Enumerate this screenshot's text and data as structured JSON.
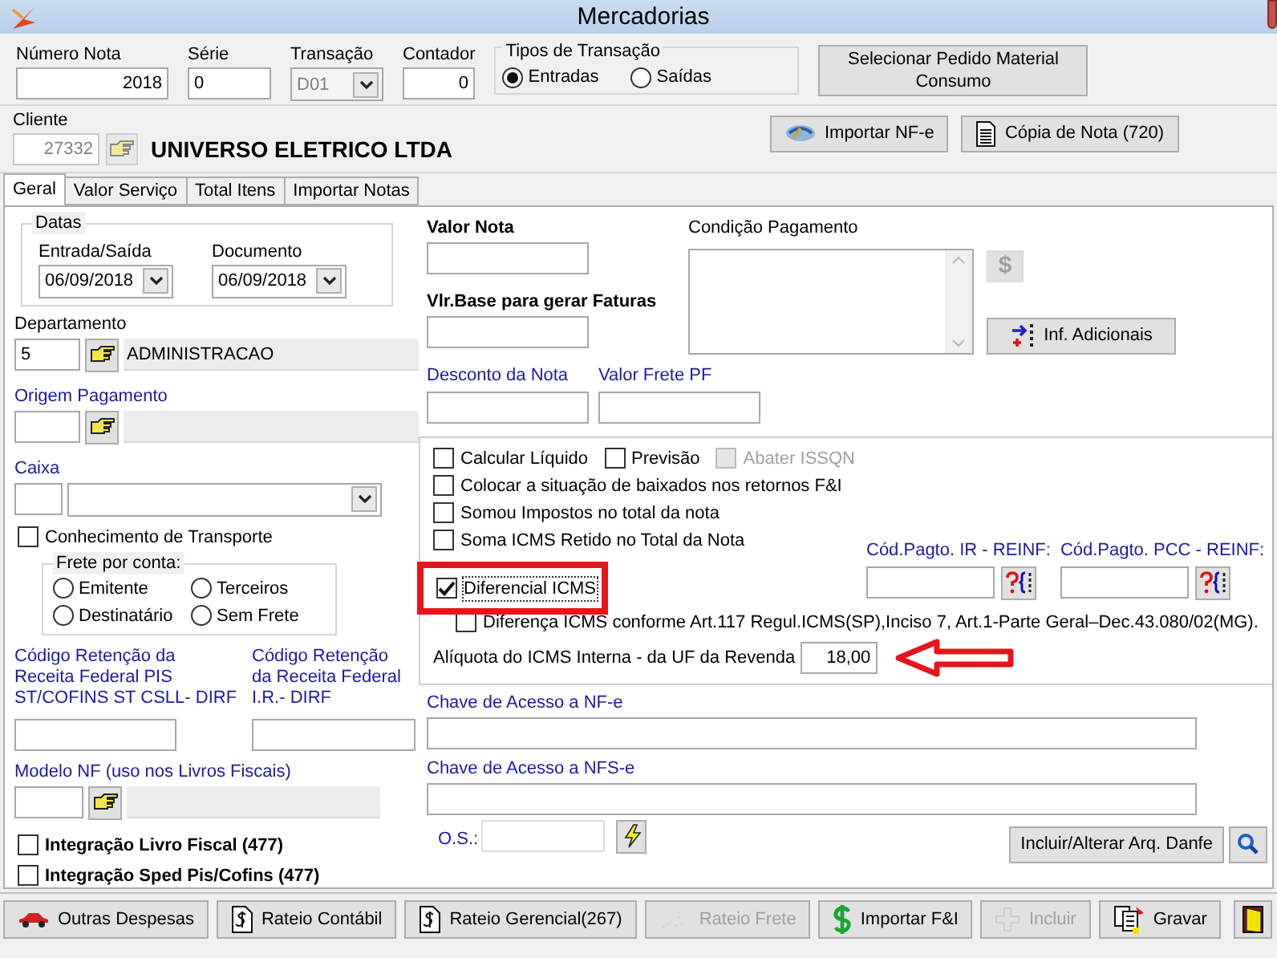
{
  "window": {
    "title": "Mercadorias"
  },
  "header": {
    "numero_nota": {
      "label": "Número Nota",
      "value": "2018"
    },
    "serie": {
      "label": "Série",
      "value": "0"
    },
    "transacao": {
      "label": "Transação",
      "value": "D01",
      "disabled": true
    },
    "contador": {
      "label": "Contador",
      "value": "0"
    },
    "tipos_transacao": {
      "title": "Tipos de Transação",
      "options": [
        {
          "label": "Entradas",
          "selected": true
        },
        {
          "label": "Saídas",
          "selected": false
        }
      ]
    },
    "select_button": "Selecionar Pedido Material Consumo"
  },
  "cliente": {
    "label": "Cliente",
    "code": "27332",
    "name": "UNIVERSO ELETRICO LTDA"
  },
  "header_buttons": [
    {
      "label": "Importar NF-e",
      "kind": "import"
    },
    {
      "label": "Cópia de Nota (720)",
      "kind": "copy"
    }
  ],
  "tabs": [
    {
      "label": "Geral",
      "selected": true
    },
    {
      "label": "Valor Serviço",
      "selected": false
    },
    {
      "label": "Total Itens",
      "selected": false
    },
    {
      "label": "Importar Notas",
      "selected": false
    }
  ],
  "left": {
    "datas": {
      "title": "Datas",
      "fields": [
        {
          "label": "Entrada/Saída",
          "value": "06/09/2018"
        },
        {
          "label": "Documento",
          "value": "06/09/2018"
        }
      ]
    },
    "departamento": {
      "label": "Departamento",
      "code": "5",
      "name": "ADMINISTRACAO"
    },
    "origem_pagamento": {
      "label": "Origem Pagamento"
    },
    "caixa": {
      "label": "Caixa"
    },
    "conhecimento_transporte": {
      "label": "Conhecimento de Transporte",
      "checked": false
    },
    "frete": {
      "title": "Frete por conta:",
      "options": [
        {
          "label": "Emitente",
          "selected": false
        },
        {
          "label": "Terceiros",
          "selected": false
        },
        {
          "label": "Destinatário",
          "selected": false
        },
        {
          "label": "Sem Frete",
          "selected": false
        }
      ]
    },
    "retencoes": [
      {
        "label": "Código Retenção da Receita Federal PIS ST/COFINS ST CSLL- DIRF"
      },
      {
        "label": "Código Retenção da Receita Federal I.R.- DIRF"
      }
    ],
    "modelo_nf": {
      "label": "Modelo NF (uso nos Livros Fiscais)"
    },
    "integracoes": [
      {
        "label": "Integração Livro Fiscal (477)",
        "checked": false
      },
      {
        "label": "Integração Sped Pis/Cofins (477)",
        "checked": false
      }
    ]
  },
  "right": {
    "valor_nota": {
      "label": "Valor Nota"
    },
    "vlr_base": {
      "label": "Vlr.Base para gerar Faturas"
    },
    "condicao_pagamento": {
      "label": "Condição Pagamento"
    },
    "dollar_button": {
      "label": "$",
      "disabled": true
    },
    "inf_adicionais": "Inf. Adicionais",
    "desconto": {
      "label": "Desconto da Nota"
    },
    "valor_frete": {
      "label": "Valor Frete PF"
    },
    "option_rows": [
      [
        {
          "label": "Calcular Líquido",
          "checked": false,
          "disabled": false
        },
        {
          "label": "Previsão",
          "checked": false,
          "disabled": false
        },
        {
          "label": "Abater ISSQN",
          "checked": false,
          "disabled": true
        }
      ],
      [
        {
          "label": "Colocar a situação de baixados nos retornos F&I",
          "checked": false,
          "disabled": false
        }
      ],
      [
        {
          "label": "Somou Impostos no total da nota",
          "checked": false,
          "disabled": false
        }
      ]
    ],
    "soma_icms": {
      "label": "Soma ICMS Retido no Total da Nota",
      "checked": false
    },
    "diferencial": {
      "label": "Diferencial ICMS",
      "checked": true,
      "highlighted": true
    },
    "diferenca": {
      "label": "Diferença ICMS conforme Art.117 Regul.ICMS(SP),Inciso 7, Art.1-Parte Geral–Dec.43.080/02(MG).",
      "checked": false
    },
    "aliquota": {
      "label": "Alíquota do ICMS Interna - da UF da Revenda",
      "value": "18,00",
      "pointed": true
    },
    "cod_pagto": [
      {
        "label": "Cód.Pagto. IR - REINF:"
      },
      {
        "label": "Cód.Pagto. PCC - REINF:"
      }
    ],
    "chave_nfe": {
      "label": "Chave de Acesso a NF-e"
    },
    "chave_nfse": {
      "label": "Chave de Acesso a NFS-e"
    },
    "os": {
      "label": "O.S.:"
    },
    "danfe_button": "Incluir/Alterar Arq. Danfe"
  },
  "toolbar": [
    {
      "label": "Outras Despesas",
      "kind": "car",
      "disabled": false
    },
    {
      "label": "Rateio Contábil",
      "kind": "doc_dollar",
      "disabled": false
    },
    {
      "label": "Rateio Gerencial(267)",
      "kind": "doc_dollar",
      "disabled": false
    },
    {
      "label": "Rateio Frete",
      "kind": "arrows",
      "disabled": true
    },
    {
      "label": "Importar F&I",
      "kind": "dollar",
      "disabled": false
    },
    {
      "label": "Incluir",
      "kind": "plus",
      "disabled": true
    },
    {
      "label": "Gravar",
      "kind": "save",
      "disabled": false
    },
    {
      "kind": "exit",
      "disabled": false
    }
  ]
}
